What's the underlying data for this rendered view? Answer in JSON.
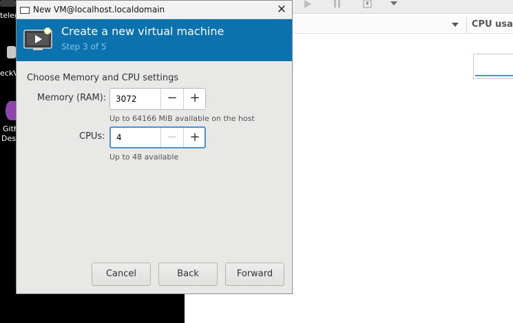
{
  "desktop": {
    "labels": [
      "teleg",
      "eckV",
      "Gith",
      "Desk"
    ]
  },
  "background_window": {
    "column_title": "CPU usa",
    "toolbar_icons": [
      "run-icon",
      "pause-icon",
      "shutdown-icon",
      "dropdown-arrow-icon"
    ]
  },
  "dialog": {
    "window_title": "New VM@localhost.localdomain",
    "close_glyph": "✕",
    "banner": {
      "title": "Create a new virtual machine",
      "step": "Step 3 of 5",
      "icon": "vm-monitor-icon"
    },
    "section_title": "Choose Memory and CPU settings",
    "memory": {
      "label": "Memory (RAM):",
      "value": "3072",
      "hint": "Up to 64166 MiB available on the host",
      "minus": "−",
      "plus": "+"
    },
    "cpus": {
      "label": "CPUs:",
      "value": "4",
      "hint": "Up to 48 available",
      "minus": "−",
      "plus": "+"
    },
    "buttons": {
      "cancel": "Cancel",
      "back": "Back",
      "forward": "Forward"
    }
  },
  "colors": {
    "banner": "#0b72ad",
    "step_text": "#7fc3ea",
    "focus_ring": "#4a90d9"
  }
}
